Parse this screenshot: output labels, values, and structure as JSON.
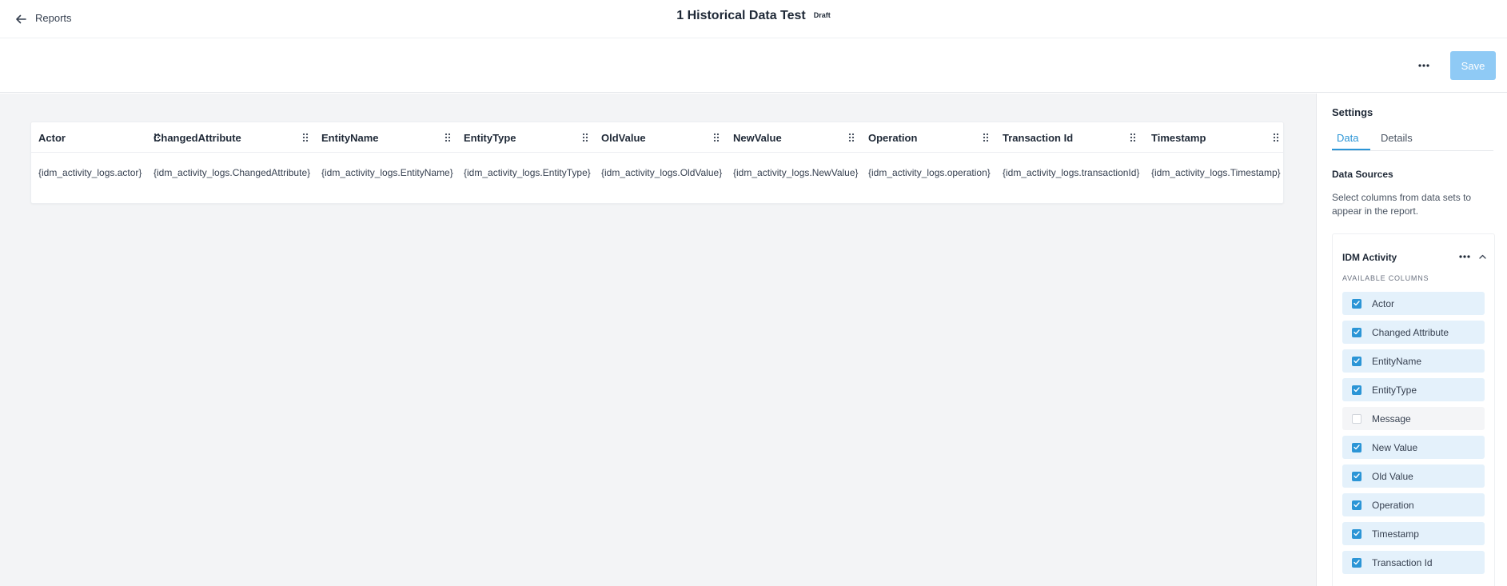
{
  "header": {
    "back_label": "Reports",
    "title": "1 Historical Data Test",
    "status_badge": "Draft"
  },
  "actions": {
    "save_label": "Save"
  },
  "table": {
    "columns": [
      {
        "header": "Actor",
        "cell": "{idm_activity_logs.actor}"
      },
      {
        "header": "ChangedAttribute",
        "cell": "{idm_activity_logs.ChangedAttribute}"
      },
      {
        "header": "EntityName",
        "cell": "{idm_activity_logs.EntityName}"
      },
      {
        "header": "EntityType",
        "cell": "{idm_activity_logs.EntityType}"
      },
      {
        "header": "OldValue",
        "cell": "{idm_activity_logs.OldValue}"
      },
      {
        "header": "NewValue",
        "cell": "{idm_activity_logs.NewValue}"
      },
      {
        "header": "Operation",
        "cell": "{idm_activity_logs.operation}"
      },
      {
        "header": "Transaction Id",
        "cell": "{idm_activity_logs.transactionId}"
      },
      {
        "header": "Timestamp",
        "cell": "{idm_activity_logs.Timestamp}"
      }
    ]
  },
  "settings": {
    "title": "Settings",
    "tabs": [
      {
        "label": "Data",
        "active": true
      },
      {
        "label": "Details",
        "active": false
      }
    ],
    "data_sources_title": "Data Sources",
    "data_sources_desc": "Select columns from data sets to appear in the report.",
    "source": {
      "name": "IDM Activity",
      "available_label": "AVAILABLE COLUMNS",
      "columns": [
        {
          "label": "Actor",
          "checked": true
        },
        {
          "label": "Changed Attribute",
          "checked": true
        },
        {
          "label": "EntityName",
          "checked": true
        },
        {
          "label": "EntityType",
          "checked": true
        },
        {
          "label": "Message",
          "checked": false
        },
        {
          "label": "New Value",
          "checked": true
        },
        {
          "label": "Old Value",
          "checked": true
        },
        {
          "label": "Operation",
          "checked": true
        },
        {
          "label": "Timestamp",
          "checked": true
        },
        {
          "label": "Transaction Id",
          "checked": true
        }
      ]
    }
  },
  "colors": {
    "accent": "#2b95d6",
    "save_button": "#8fcaf5",
    "canvas_bg": "#f3f4f6",
    "checked_row_bg": "#e4f1fb"
  }
}
